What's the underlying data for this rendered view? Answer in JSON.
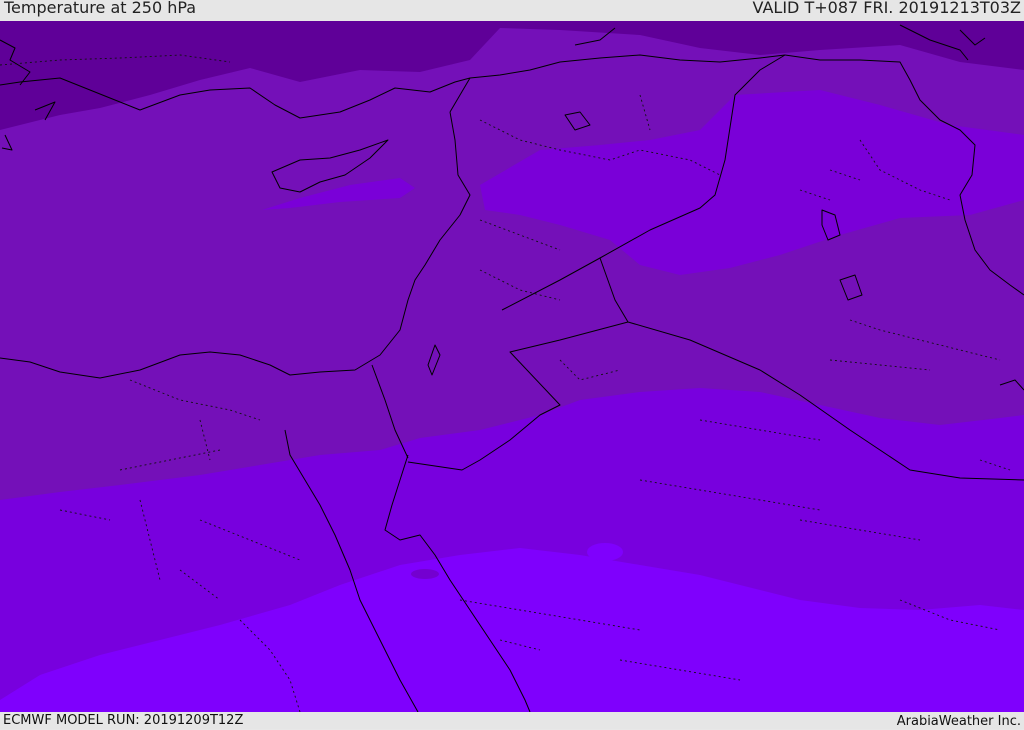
{
  "header": {
    "title": "Temperature at 250 hPa",
    "valid": "VALID T+087 FRI. 20191213T03Z"
  },
  "footer": {
    "model_run": "ECMWF MODEL RUN: 20191209T12Z",
    "credit": "ArabiaWeather Inc."
  },
  "palette": {
    "coldest": "#5c0094",
    "colder": "#6a00a6",
    "cold": "#7410b8",
    "mid": "#7600d6",
    "warm": "#7d00f0",
    "warmest": "#8000ff",
    "coastline": "#000000"
  }
}
